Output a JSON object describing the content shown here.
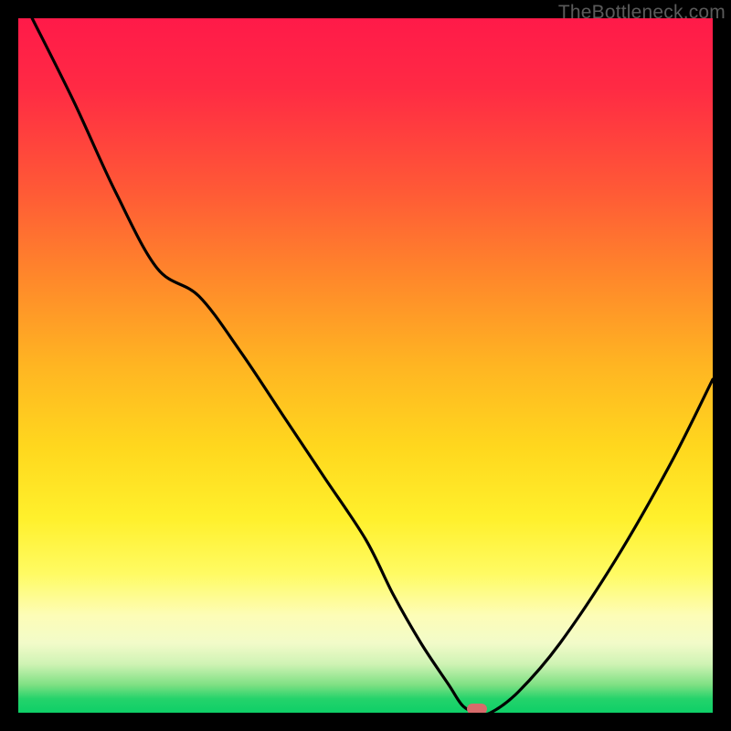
{
  "watermark": "TheBottleneck.com",
  "colors": {
    "grad_top": "#ff1a49",
    "grad_bottom": "#0ecf67",
    "curve": "#000000",
    "marker": "#d66b6b",
    "background": "#000000"
  },
  "chart_data": {
    "type": "line",
    "title": "",
    "xlabel": "",
    "ylabel": "",
    "xlim": [
      0,
      100
    ],
    "ylim": [
      0,
      100
    ],
    "grid": false,
    "series": [
      {
        "name": "bottleneck-curve",
        "x": [
          2,
          8,
          14,
          20,
          26,
          32,
          38,
          44,
          50,
          54,
          58,
          62,
          64,
          66,
          68,
          72,
          78,
          86,
          94,
          100
        ],
        "y": [
          100,
          88,
          75,
          64,
          60,
          52,
          43,
          34,
          25,
          17,
          10,
          4,
          1,
          0,
          0,
          3,
          10,
          22,
          36,
          48
        ]
      }
    ],
    "annotations": [
      {
        "name": "optimal-marker",
        "x": 66,
        "y": 0.5
      }
    ]
  }
}
